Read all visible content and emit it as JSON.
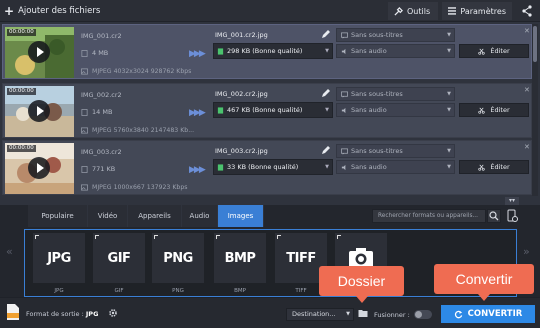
{
  "toolbar": {
    "add_files": "Ajouter des fichiers",
    "tools": "Outils",
    "settings": "Paramètres"
  },
  "files": [
    {
      "timecode": "00:00:00",
      "name": "IMG_001.cr2",
      "size": "4 MB",
      "meta": "MJPEG 4032x3024 928762 Kbps",
      "output_name": "IMG_001.cr2.jpg",
      "output_size": "298 KB (Bonne qualité)",
      "subtitles": "Sans sous-titres",
      "audio": "Sans audio",
      "edit": "Éditer"
    },
    {
      "timecode": "00:00:00",
      "name": "IMG_002.cr2",
      "size": "14 MB",
      "meta": "MJPEG 5760x3840 2147483 Kb...",
      "output_name": "IMG_002.cr2.jpg",
      "output_size": "467 KB (Bonne qualité)",
      "subtitles": "Sans sous-titres",
      "audio": "Sans audio",
      "edit": "Éditer"
    },
    {
      "timecode": "00:00:00",
      "name": "IMG_003.cr2",
      "size": "771 KB",
      "meta": "MJPEG 1000x667 137923 Kbps",
      "output_name": "IMG_003.cr2.jpg",
      "output_size": "33 KB (Bonne qualité)",
      "subtitles": "Sans sous-titres",
      "audio": "Sans audio",
      "edit": "Éditer"
    }
  ],
  "format_tabs": [
    "Populaire",
    "Vidéo",
    "Appareils",
    "Audio",
    "Images"
  ],
  "active_tab": "Images",
  "search_placeholder": "Rechercher formats ou appareils...",
  "formats": [
    {
      "big": "JPG",
      "label": "JPG"
    },
    {
      "big": "GIF",
      "label": "GIF"
    },
    {
      "big": "PNG",
      "label": "PNG"
    },
    {
      "big": "BMP",
      "label": "BMP"
    },
    {
      "big": "TIFF",
      "label": "TIFF"
    },
    {
      "big": "",
      "label": ""
    }
  ],
  "bottom": {
    "output_label": "Format de sortie :",
    "output_value": "JPG",
    "destination": "Destination...",
    "merge": "Fusionner :",
    "convert": "CONVERTIR"
  },
  "callouts": {
    "folder": "Dossier",
    "convert": "Convertir"
  },
  "colors": {
    "accent": "#3a7fd5",
    "convert_button": "#2d89e6",
    "callout": "#ef6c52"
  }
}
